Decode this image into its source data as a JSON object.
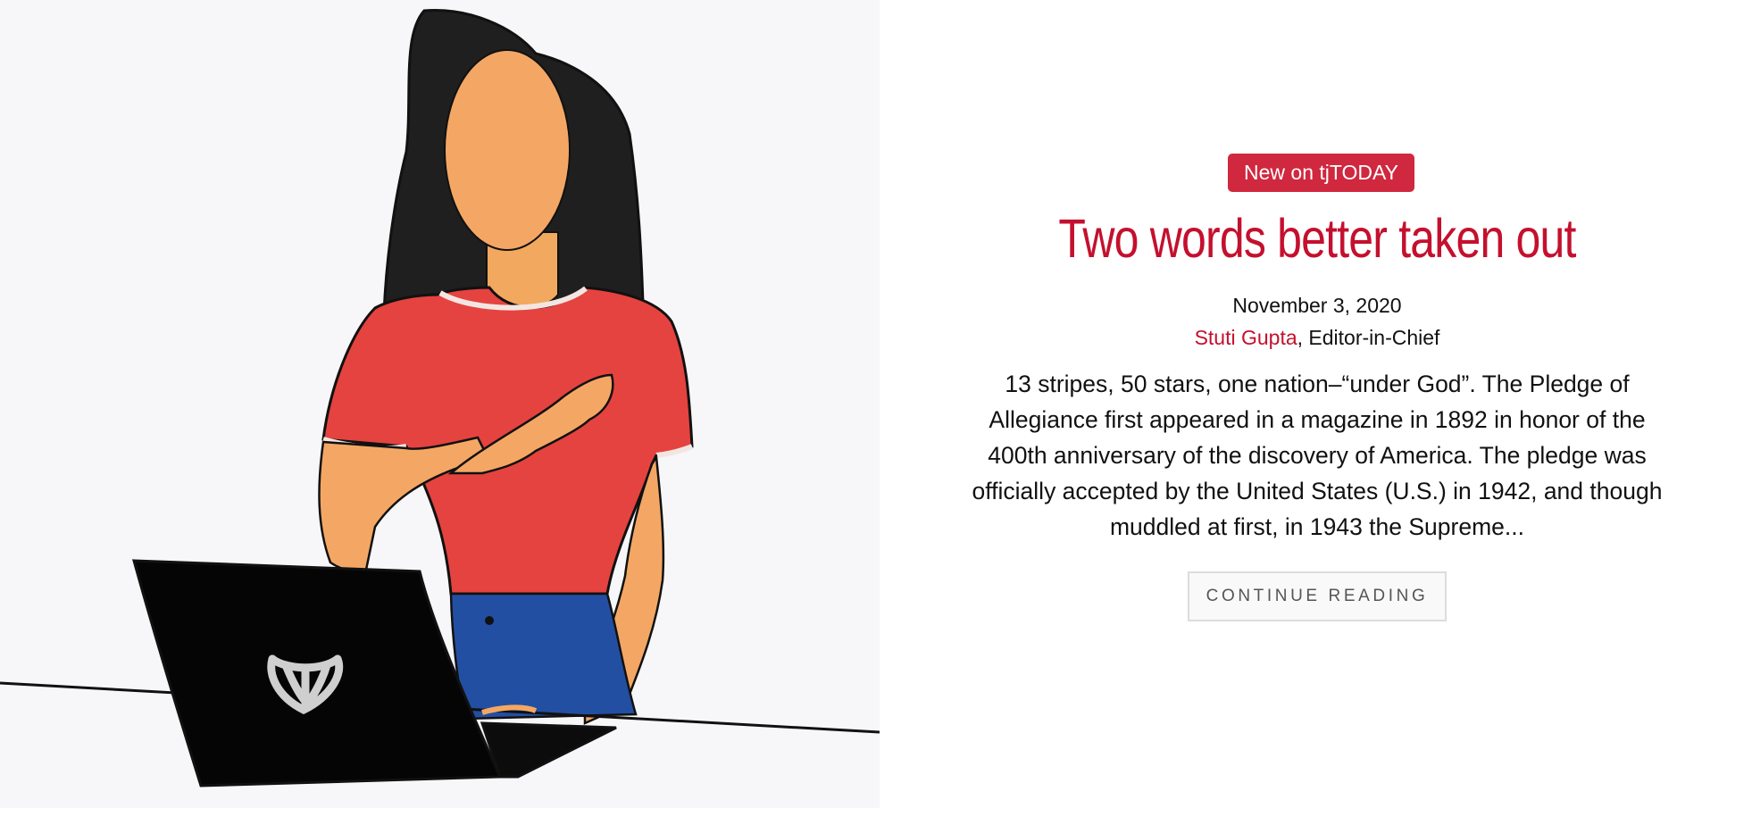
{
  "post": {
    "badge": "New on tjTODAY",
    "title": "Two words better taken out",
    "date": "November 3, 2020",
    "author": "Stuti Gupta",
    "author_suffix": ", Editor-in-Chief",
    "excerpt": "13 stripes, 50 stars, one nation–“under God”. The Pledge of Allegiance first appeared in a magazine in 1892 in honor of the 400th anniversary of the discovery of America. The pledge was officially accepted by the United States (U.S.) in 1942, and though muddled at first, in 1943 the Supreme...",
    "continue_label": "CONTINUE READING"
  },
  "colors": {
    "accent": "#c4102e",
    "badge_bg": "#d0283f",
    "text": "#111111",
    "button_bg": "#f9f9f9",
    "button_border": "#dcdcdc"
  },
  "illustration": {
    "subject": "girl-hand-on-heart-with-laptop",
    "icons": [
      "laptop-icon",
      "tj-logo-icon"
    ]
  }
}
